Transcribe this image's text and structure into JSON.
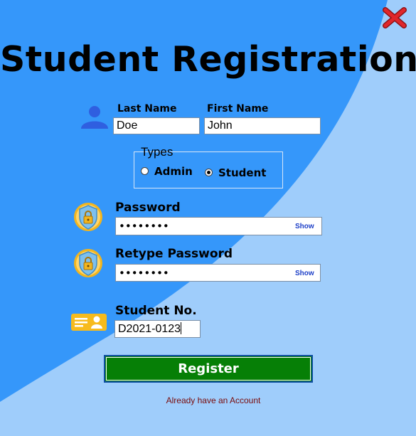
{
  "form": {
    "title": "Student Registration",
    "last_name_label": "Last Name",
    "first_name_label": "First Name",
    "last_name_value": "Doe",
    "first_name_value": "John",
    "types_label": "Types",
    "type_options": [
      "Admin",
      "Student"
    ],
    "selected_type": "Student",
    "password_label": "Password",
    "password_value": "••••••••",
    "retype_password_label": "Retype Password",
    "retype_password_value": "••••••••",
    "show_label": "Show",
    "student_no_label": "Student No.",
    "student_no_value": "D2021-0123",
    "register_label": "Register",
    "login_link": "Already have an Account"
  },
  "colors": {
    "bg_dark": "#3597fa",
    "bg_light": "#9fcdfb",
    "register_bg": "#067f06",
    "close_red": "#e0262b",
    "link": "#7a0b0b"
  },
  "icons": [
    "close-icon",
    "user-icon",
    "lock-shield-icon",
    "id-card-icon"
  ]
}
